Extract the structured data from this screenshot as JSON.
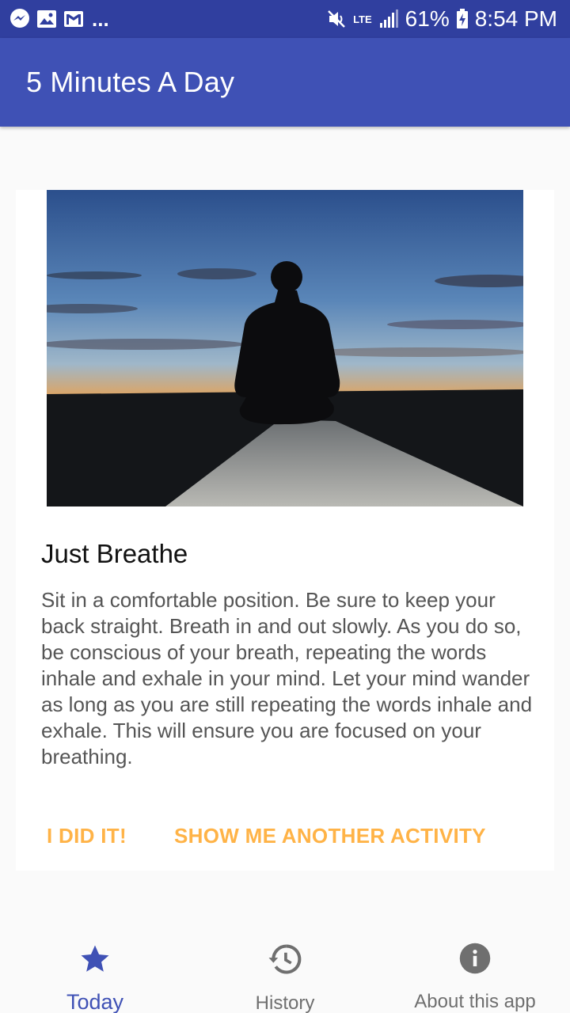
{
  "status_bar": {
    "more_indicator": "...",
    "network": "LTE",
    "battery_percent": "61%",
    "time": "8:54 PM"
  },
  "app_bar": {
    "title": "5 Minutes A Day"
  },
  "activity": {
    "title": "Just Breathe",
    "description": "Sit in a comfortable position. Be sure to keep your back straight. Breath in and out slowly. As you do so, be conscious of your breath, repeating the words inhale and exhale in your mind. Let your mind wander as long as you are still repeating the words inhale and exhale. This will ensure you are focused on your breathing.",
    "done_button": "I DID IT!",
    "another_button": "SHOW ME ANOTHER ACTIVITY"
  },
  "bottom_nav": {
    "items": [
      {
        "label": "Today",
        "icon": "star-icon",
        "active": true
      },
      {
        "label": "History",
        "icon": "history-icon",
        "active": false
      },
      {
        "label": "About this app",
        "icon": "info-icon",
        "active": false
      }
    ]
  },
  "colors": {
    "status_bar": "#303f9f",
    "primary": "#3f51b5",
    "accent": "#ffb347",
    "inactive_nav": "#6f6f6f"
  }
}
